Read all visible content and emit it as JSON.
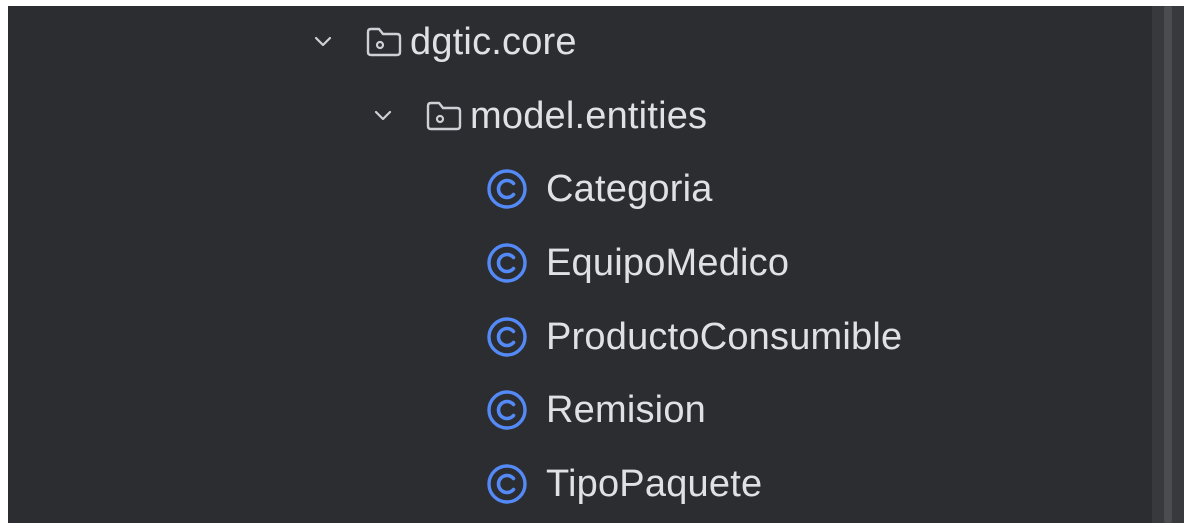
{
  "project_tree": {
    "package_root": {
      "label": "dgtic.core",
      "icon": "package-folder-icon",
      "expanded": true
    },
    "package_child": {
      "label": "model.entities",
      "icon": "package-folder-icon",
      "expanded": true
    },
    "classes": [
      {
        "label": "Categoria",
        "icon": "class-icon"
      },
      {
        "label": "EquipoMedico",
        "icon": "class-icon"
      },
      {
        "label": "ProductoConsumible",
        "icon": "class-icon"
      },
      {
        "label": "Remision",
        "icon": "class-icon"
      },
      {
        "label": "TipoPaquete",
        "icon": "class-icon"
      }
    ]
  },
  "colors": {
    "background": "#2b2d30",
    "text": "#dfe1e5",
    "class_icon": "#548af7",
    "folder_icon": "#ced0d6"
  }
}
